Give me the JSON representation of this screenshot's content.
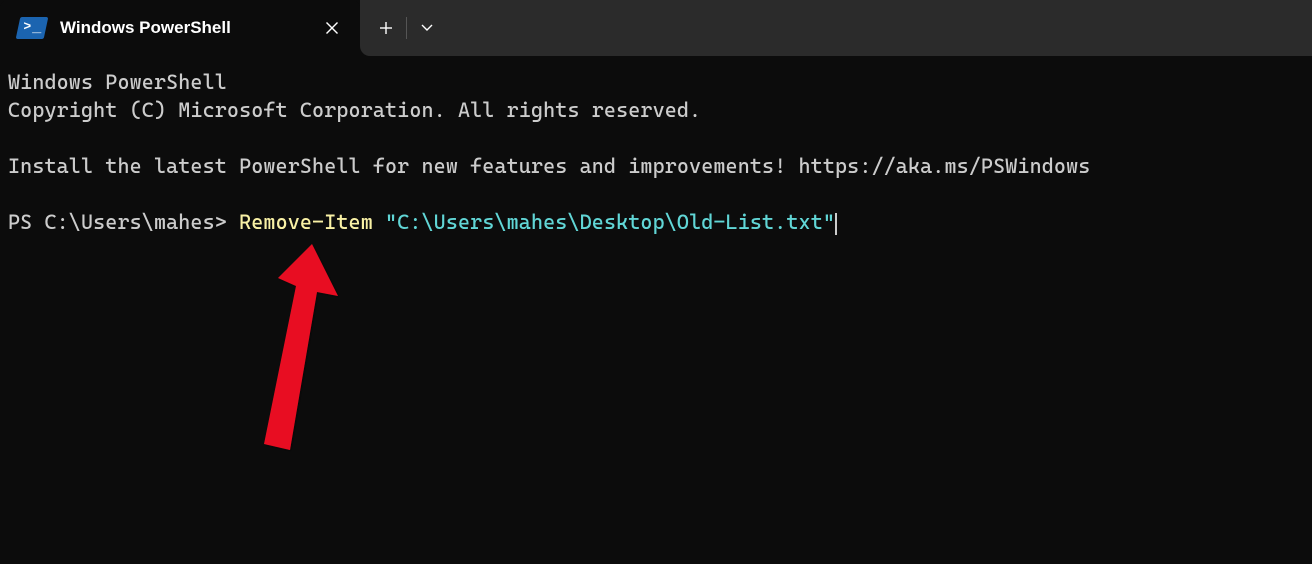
{
  "tab": {
    "title": "Windows PowerShell"
  },
  "terminal": {
    "line1": "Windows PowerShell",
    "line2": "Copyright (C) Microsoft Corporation. All rights reserved.",
    "line3": "Install the latest PowerShell for new features and improvements! https://aka.ms/PSWindows",
    "prompt": "PS C:\\Users\\mahes> ",
    "cmd_cmdlet": "Remove-Item",
    "cmd_space": " ",
    "cmd_arg": "\"C:\\Users\\mahes\\Desktop\\Old-List.txt\""
  }
}
